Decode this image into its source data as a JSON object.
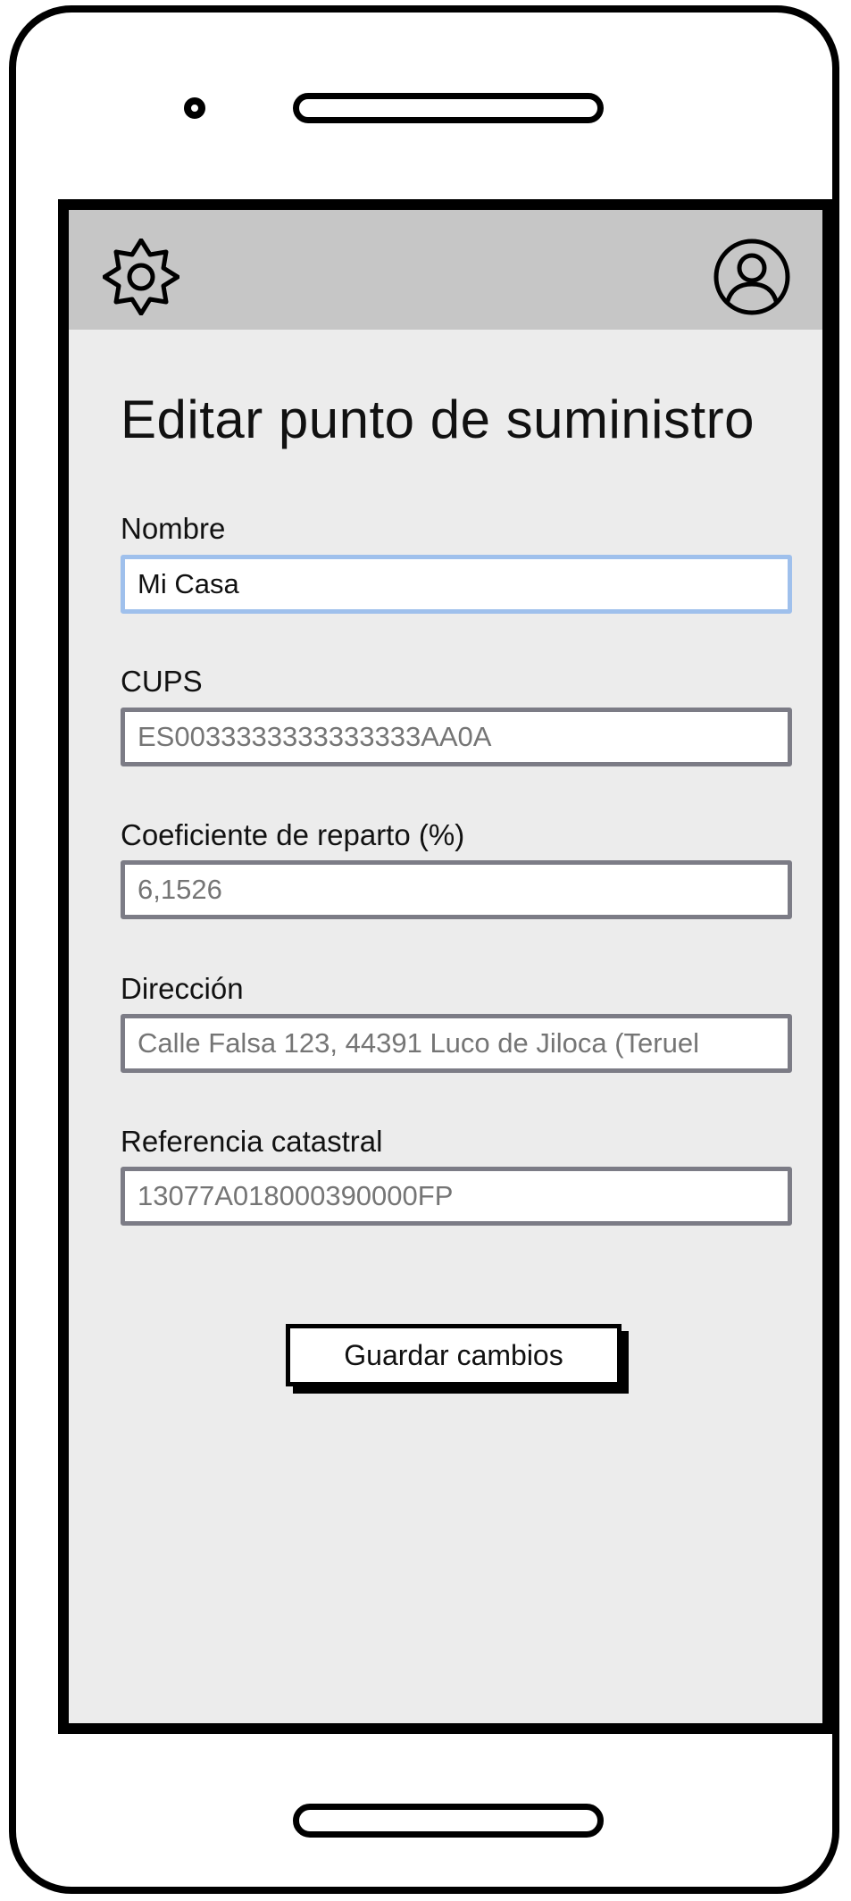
{
  "header": {
    "settings_icon": "gear-icon",
    "profile_icon": "user-circle-icon"
  },
  "page": {
    "title": "Editar punto de suministro"
  },
  "form": {
    "nombre": {
      "label": "Nombre",
      "value": "Mi Casa"
    },
    "cups": {
      "label": "CUPS",
      "placeholder": "ES0033333333333333AA0A"
    },
    "coeficiente": {
      "label": "Coeficiente de reparto (%)",
      "placeholder": "6,1526"
    },
    "direccion": {
      "label": "Dirección",
      "placeholder": "Calle Falsa 123, 44391 Luco de Jiloca (Teruel"
    },
    "referencia": {
      "label": "Referencia catastral",
      "placeholder": "13077A018000390000FP"
    }
  },
  "actions": {
    "save_label": "Guardar cambios"
  }
}
